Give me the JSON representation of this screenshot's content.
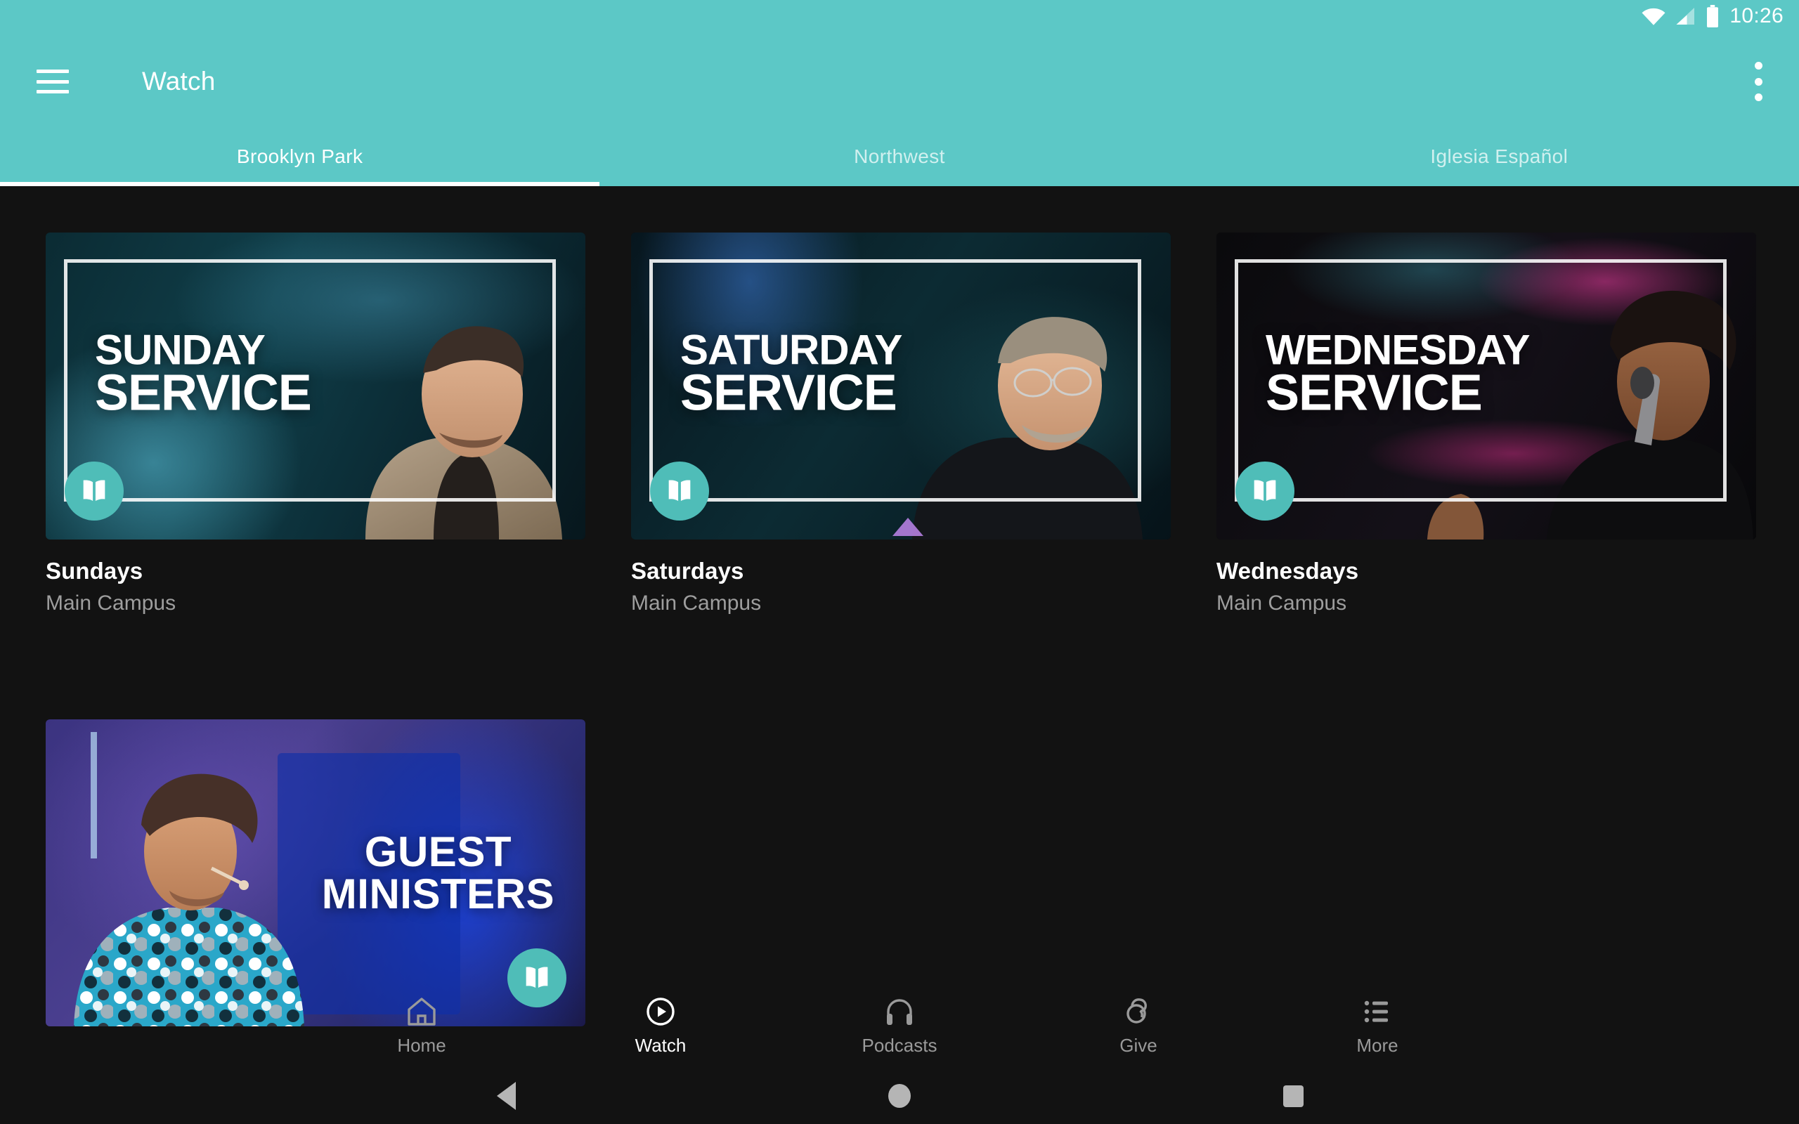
{
  "status_bar": {
    "time": "10:26",
    "icons": [
      "wifi-icon",
      "cell-signal-icon",
      "battery-icon"
    ]
  },
  "app_bar": {
    "menu_icon": "hamburger-menu-icon",
    "title": "Watch",
    "overflow_icon": "overflow-menu-icon"
  },
  "tabs": [
    {
      "label": "Brooklyn Park",
      "active": true
    },
    {
      "label": "Northwest",
      "active": false
    },
    {
      "label": "Iglesia Español",
      "active": false
    }
  ],
  "theme": {
    "accent": "#5CC8C6",
    "badge": "#4FBDB8",
    "background": "#121212",
    "text_primary": "#FFFFFF",
    "text_secondary": "#9E9E9E",
    "nav_inactive": "#9A9A9A"
  },
  "cards": [
    {
      "title": "Sundays",
      "subtitle": "Main Campus",
      "artwork_line1": "SUNDAY",
      "artwork_line2": "SERVICE",
      "badge_icon": "open-book-icon",
      "badge_position": "left"
    },
    {
      "title": "Saturdays",
      "subtitle": "Main Campus",
      "artwork_line1": "SATURDAY",
      "artwork_line2": "SERVICE",
      "badge_icon": "open-book-icon",
      "badge_position": "left"
    },
    {
      "title": "Wednesdays",
      "subtitle": "Main Campus",
      "artwork_line1": "WEDNESDAY",
      "artwork_line2": "SERVICE",
      "badge_icon": "open-book-icon",
      "badge_position": "left"
    },
    {
      "title": "",
      "subtitle": "",
      "artwork_line1": "GUEST",
      "artwork_line2": "MINISTERS",
      "badge_icon": "open-book-icon",
      "badge_position": "right"
    }
  ],
  "bottom_nav": [
    {
      "label": "Home",
      "icon": "home-icon",
      "active": false
    },
    {
      "label": "Watch",
      "icon": "play-circle-icon",
      "active": true
    },
    {
      "label": "Podcasts",
      "icon": "headphones-icon",
      "active": false
    },
    {
      "label": "Give",
      "icon": "giving-hand-icon",
      "active": false
    },
    {
      "label": "More",
      "icon": "list-icon",
      "active": false
    }
  ],
  "system_nav": [
    {
      "name": "back",
      "icon": "back-triangle-icon"
    },
    {
      "name": "home",
      "icon": "home-circle-icon"
    },
    {
      "name": "recents",
      "icon": "recents-square-icon"
    }
  ]
}
